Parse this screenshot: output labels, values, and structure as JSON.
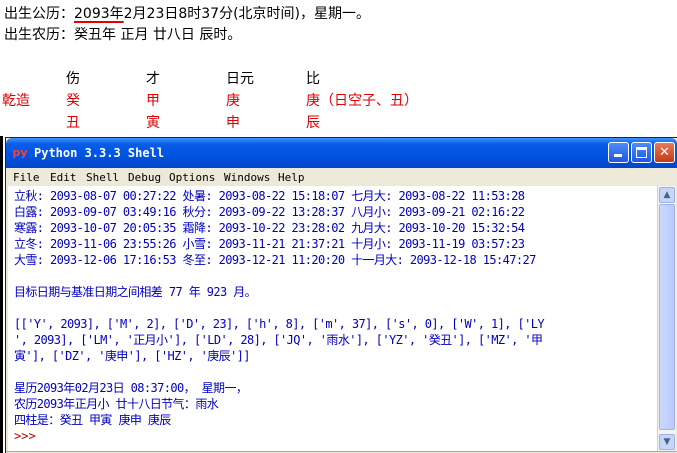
{
  "document": {
    "line1_before": "出生公历：",
    "line1_year": "2093年",
    "line1_after": "2月23日8时37分(北京时间)，星期一。",
    "line2": "出生农历：癸丑年 正月 廿八日 辰时。",
    "pillars": {
      "headers": [
        "伤",
        "才",
        "日元",
        "比"
      ],
      "row_label": "乾造",
      "stems": [
        "癸",
        "甲",
        "庚",
        "庚（日空子、丑）"
      ],
      "branches": [
        "丑",
        "寅",
        "申",
        "辰"
      ]
    }
  },
  "shell": {
    "title": "Python 3.3.3 Shell",
    "icon": "py",
    "menus": [
      "File",
      "Edit",
      "Shell",
      "Debug",
      "Options",
      "Windows",
      "Help"
    ],
    "lines": [
      "立秋: 2093-08-07 00:27:22 处暑: 2093-08-22 15:18:07 七月大: 2093-08-22 11:53:28",
      "白露: 2093-09-07 03:49:16 秋分: 2093-09-22 13:28:37 八月小: 2093-09-21 02:16:22",
      "寒露: 2093-10-07 20:05:35 霜降: 2093-10-22 23:28:02 九月大: 2093-10-20 15:32:54",
      "立冬: 2093-11-06 23:55:26 小雪: 2093-11-21 21:37:21 十月小: 2093-11-19 03:57:23",
      "大雪: 2093-12-06 17:16:53 冬至: 2093-12-21 11:20:20 十一月大: 2093-12-18 15:47:27",
      "",
      "目标日期与基准日期之间相差 77 年 923 月。",
      "",
      "[['Y', 2093], ['M', 2], ['D', 23], ['h', 8], ['m', 37], ['s', 0], ['W', 1], ['LY",
      "', 2093], ['LM', '正月小'], ['LD', 28], ['JQ', '雨水'], ['YZ', '癸丑'], ['MZ', '甲",
      "寅'], ['DZ', '庚申'], ['HZ', '庚辰']]",
      "",
      "星历2093年02月23日 08:37:00， 星期一，",
      "农历2093年正月小 廿十八日节气：雨水",
      "四柱是：癸丑 甲寅 庚申 庚辰"
    ],
    "prompt": ">>>"
  },
  "scrollbar": {
    "up_icon": "arrow-up-icon",
    "down_icon": "arrow-down-icon"
  },
  "colors": {
    "shell_text": "#0000c0",
    "prompt": "#c00000",
    "pillar_red": "#e00000",
    "titlebar": "#0054e3"
  }
}
